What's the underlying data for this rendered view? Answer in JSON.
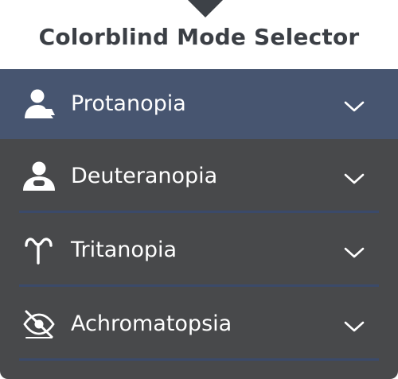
{
  "header": {
    "title": "Colorblind Mode Selector"
  },
  "colors": {
    "panel": "#48494b",
    "selected_row": "#475570",
    "divider": "#3b4a6a",
    "text": "#ffffff",
    "title": "#3b3f45"
  },
  "modes": [
    {
      "label": "Protanopia",
      "icon": "person-icon",
      "selected": true
    },
    {
      "label": "Deuteranopia",
      "icon": "person-badge-icon",
      "selected": false
    },
    {
      "label": "Tritanopia",
      "icon": "horseshoe-icon",
      "selected": false
    },
    {
      "label": "Achromatopsia",
      "icon": "crossed-eye-icon",
      "selected": false
    }
  ]
}
